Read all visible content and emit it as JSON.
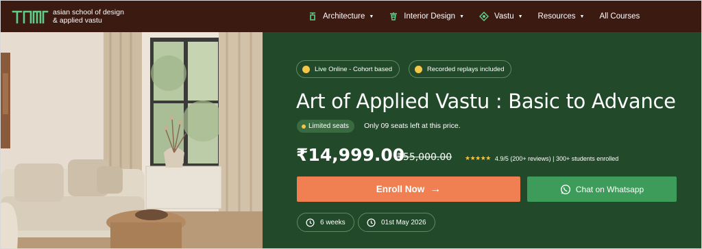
{
  "brand": {
    "line1": "asian school of design",
    "line2": "& applied vastu"
  },
  "nav": {
    "items": [
      {
        "label": "Architecture",
        "icon": "architecture-icon",
        "dropdown": true
      },
      {
        "label": "Interior Design",
        "icon": "interior-design-icon",
        "dropdown": true
      },
      {
        "label": "Vastu",
        "icon": "vastu-icon",
        "dropdown": true
      },
      {
        "label": "Resources",
        "icon": "",
        "dropdown": true
      },
      {
        "label": "All Courses",
        "icon": "",
        "dropdown": false
      }
    ]
  },
  "course": {
    "badges": [
      "Live Online - Cohort based",
      "Recorded replays included"
    ],
    "title": "Art of Applied Vastu : Basic to Advance",
    "limited_label": "Limited seats",
    "seats_text": "Only 09 seats left at this price.",
    "price": "₹14,999.00",
    "old_price": "₹55,000.00",
    "rating_text": "4.9/5  (200+ reviews) | 300+ students enrolled",
    "rating_value": 4.9,
    "enroll_label": "Enroll Now",
    "whatsapp_label": "Chat on Whatsapp",
    "duration": "6 weeks",
    "start_date": "01st May 2026"
  },
  "colors": {
    "nav_bg": "#3b1a12",
    "panel_bg": "#224a2a",
    "accent_orange": "#f07f52",
    "whatsapp_green": "#3d9c59",
    "star_yellow": "#f4c64a",
    "logo_green": "#5fd08a"
  }
}
